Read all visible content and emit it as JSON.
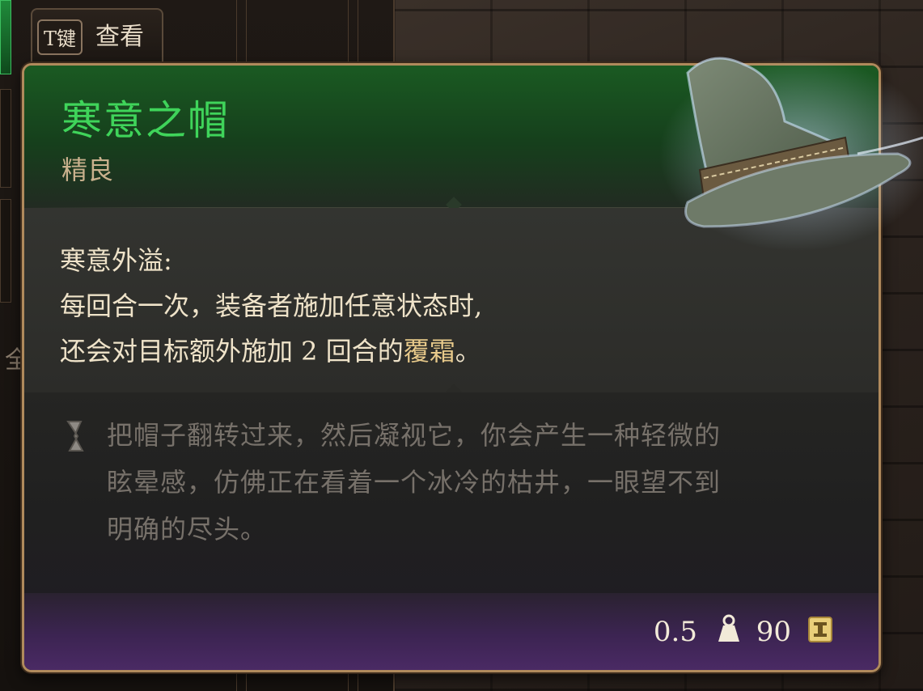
{
  "hud": {
    "inspect_key": "T键",
    "inspect_label": "查看",
    "partial_glyph": "全"
  },
  "item": {
    "name": "寒意之帽",
    "rarity": "精良",
    "rarity_color": "#3fd45a",
    "effect": {
      "name": "寒意外溢:",
      "line1": "每回合一次，装备者施加任意状态时,",
      "line2_prefix": "还会对目标额外施加 2 回合的",
      "line2_highlight": "覆霜",
      "line2_suffix": "。"
    },
    "flavor_icon": "scroll-icon",
    "flavor": {
      "line1": "把帽子翻转过来，然后凝视它，你会产生一种轻微的",
      "line2": "眩晕感，仿佛正在看着一个冰冷的枯井，一眼望不到",
      "line3": "明确的尽头。"
    },
    "weight": "0.5",
    "weight_icon": "weight-icon",
    "price": "90",
    "price_icon": "gold-coin-icon"
  }
}
